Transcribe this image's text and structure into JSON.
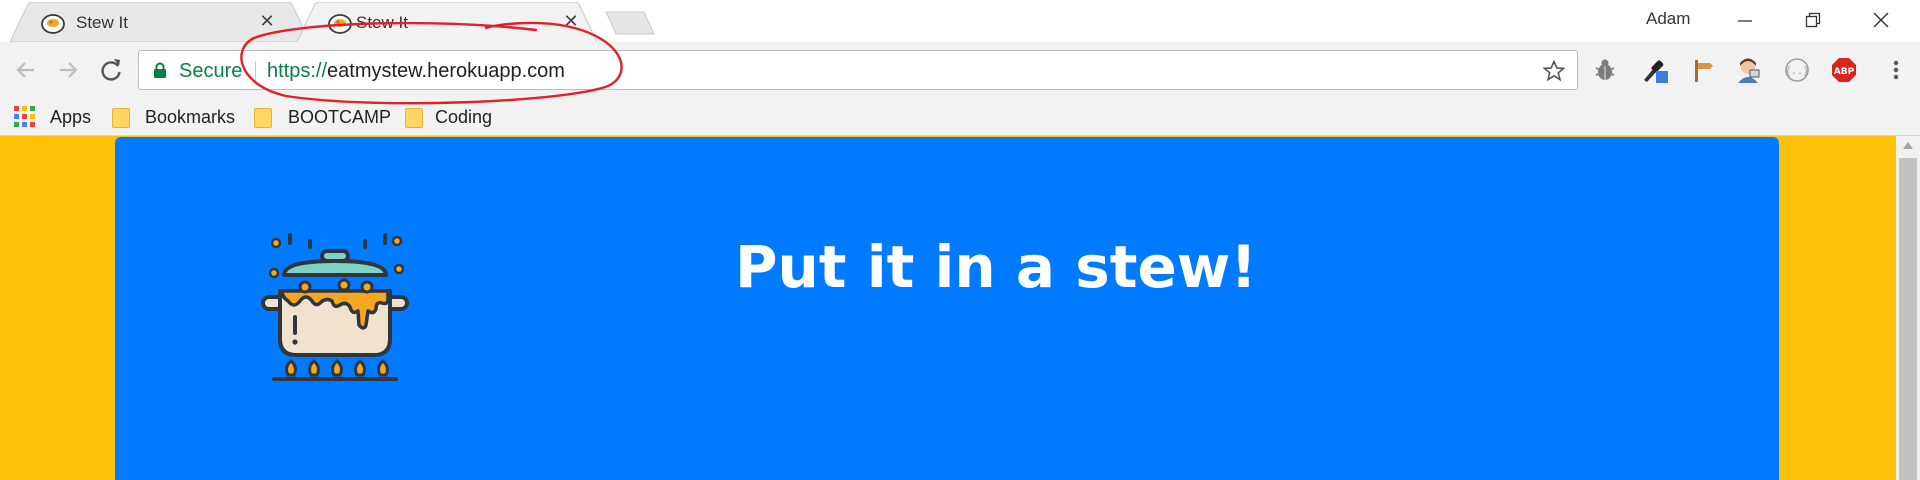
{
  "browser": {
    "tabs": [
      {
        "title": "Stew It",
        "active": false
      },
      {
        "title": "Stew It",
        "active": true
      }
    ],
    "profile_name": "Adam",
    "omnibox": {
      "security_label": "Secure",
      "url_scheme": "https://",
      "url_host": "eatmystew.herokuapp.com"
    },
    "bookmarks": [
      {
        "label": "Apps",
        "icon": "apps-grid-icon"
      },
      {
        "label": "Bookmarks",
        "icon": "folder-icon"
      },
      {
        "label": "BOOTCAMP",
        "icon": "folder-icon"
      },
      {
        "label": "Coding",
        "icon": "folder-icon"
      }
    ],
    "extensions": [
      "bug-icon",
      "eyedropper-icon",
      "signpost-icon",
      "avatar-icon",
      "code-braces-icon",
      "adblock-plus-icon"
    ],
    "adblock_label": "ABP"
  },
  "page": {
    "heading": "Put it in a stew!",
    "background_color": "#ffc107",
    "hero_color": "#007bff"
  },
  "colors": {
    "secure_green": "#0b8043",
    "annotation_red": "#e0202a"
  }
}
